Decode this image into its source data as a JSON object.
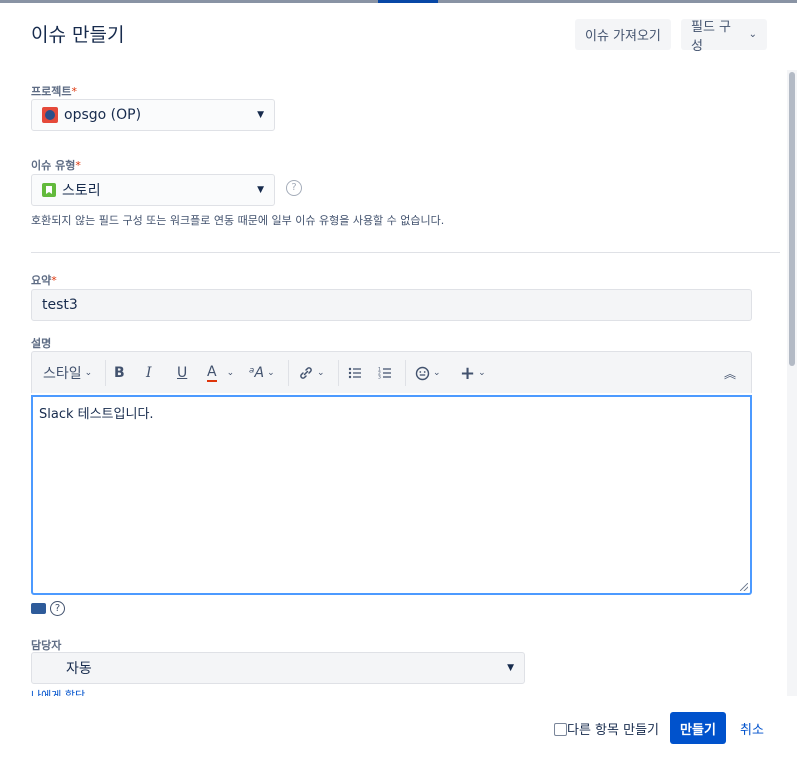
{
  "dialog": {
    "title": "이슈 만들기",
    "import_button": "이슈 가져오기",
    "configure_fields_button": "필드 구성"
  },
  "project": {
    "label": "프로젝트",
    "required_mark": "*",
    "value": "opsgo (OP)"
  },
  "issue_type": {
    "label": "이슈 유형",
    "required_mark": "*",
    "value": "스토리",
    "note": "호환되지 않는 필드 구성 또는 워크플로 연동 때문에 일부 이슈 유형을 사용할 수 없습니다."
  },
  "summary": {
    "label": "요약",
    "required_mark": "*",
    "value": "test3"
  },
  "description": {
    "label": "설명",
    "toolbar": {
      "style_label": "스타일",
      "bold": "B",
      "italic": "I",
      "underline": "U",
      "text_color": "A"
    },
    "content": "Slack 테스트입니다."
  },
  "assignee": {
    "label": "담당자",
    "value": "자동",
    "assign_to_me_link": "나에게 할당"
  },
  "footer": {
    "create_another_label": "다른 항목 만들기",
    "create_button": "만들기",
    "cancel_link": "취소"
  },
  "colors": {
    "primary": "#0052cc",
    "required": "#de350b",
    "focus_border": "#4c9aff"
  }
}
